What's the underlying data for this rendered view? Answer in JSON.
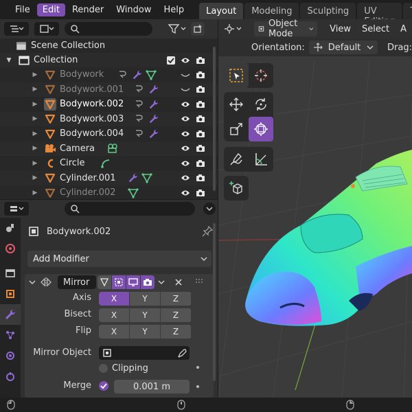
{
  "menu": {
    "items": [
      {
        "label": "File",
        "active": false
      },
      {
        "label": "Edit",
        "active": true
      },
      {
        "label": "Render",
        "active": false
      },
      {
        "label": "Window",
        "active": false
      },
      {
        "label": "Help",
        "active": false
      }
    ]
  },
  "workspaces": [
    "Layout",
    "Modeling",
    "Sculpting",
    "UV Editing",
    "Te"
  ],
  "outliner": {
    "search_placeholder": "",
    "scene_collection": "Scene Collection",
    "collection": "Collection",
    "objects": [
      {
        "name": "Bodywork",
        "type": "mesh",
        "dim": true
      },
      {
        "name": "Bodywork.001",
        "type": "mesh",
        "dim": true
      },
      {
        "name": "Bodywork.002",
        "type": "mesh",
        "dim": false,
        "selected": true
      },
      {
        "name": "Bodywork.003",
        "type": "mesh",
        "dim": false
      },
      {
        "name": "Bodywork.004",
        "type": "mesh",
        "dim": false
      },
      {
        "name": "Camera",
        "type": "camera",
        "dim": false
      },
      {
        "name": "Circle",
        "type": "curve",
        "dim": false
      },
      {
        "name": "Cylinder.001",
        "type": "mesh",
        "dim": false
      },
      {
        "name": "Cylinder.002",
        "type": "mesh",
        "dim": true
      }
    ]
  },
  "properties": {
    "object_name": "Bodywork.002",
    "add_modifier": "Add Modifier",
    "modifier": {
      "name": "Mirror",
      "axis_label": "Axis",
      "bisect_label": "Bisect",
      "flip_label": "Flip",
      "xyz": [
        "X",
        "Y",
        "Z"
      ],
      "axis_active": "X",
      "mirror_object_label": "Mirror Object",
      "clipping_label": "Clipping",
      "merge_label": "Merge",
      "merge_value": "0.001 m"
    }
  },
  "viewport": {
    "mode": "Object Mode",
    "menus": [
      "View",
      "Select",
      "A"
    ],
    "orientation_label": "Orientation:",
    "orientation_value": "Default",
    "drag_label": "Drag:"
  },
  "colors": {
    "accent": "#7d4fb0",
    "mesh_orange": "#e8893a",
    "modifier_purple": "#8e6ad6",
    "data_green": "#5fcc8a",
    "camera_orange": "#e8893a"
  }
}
